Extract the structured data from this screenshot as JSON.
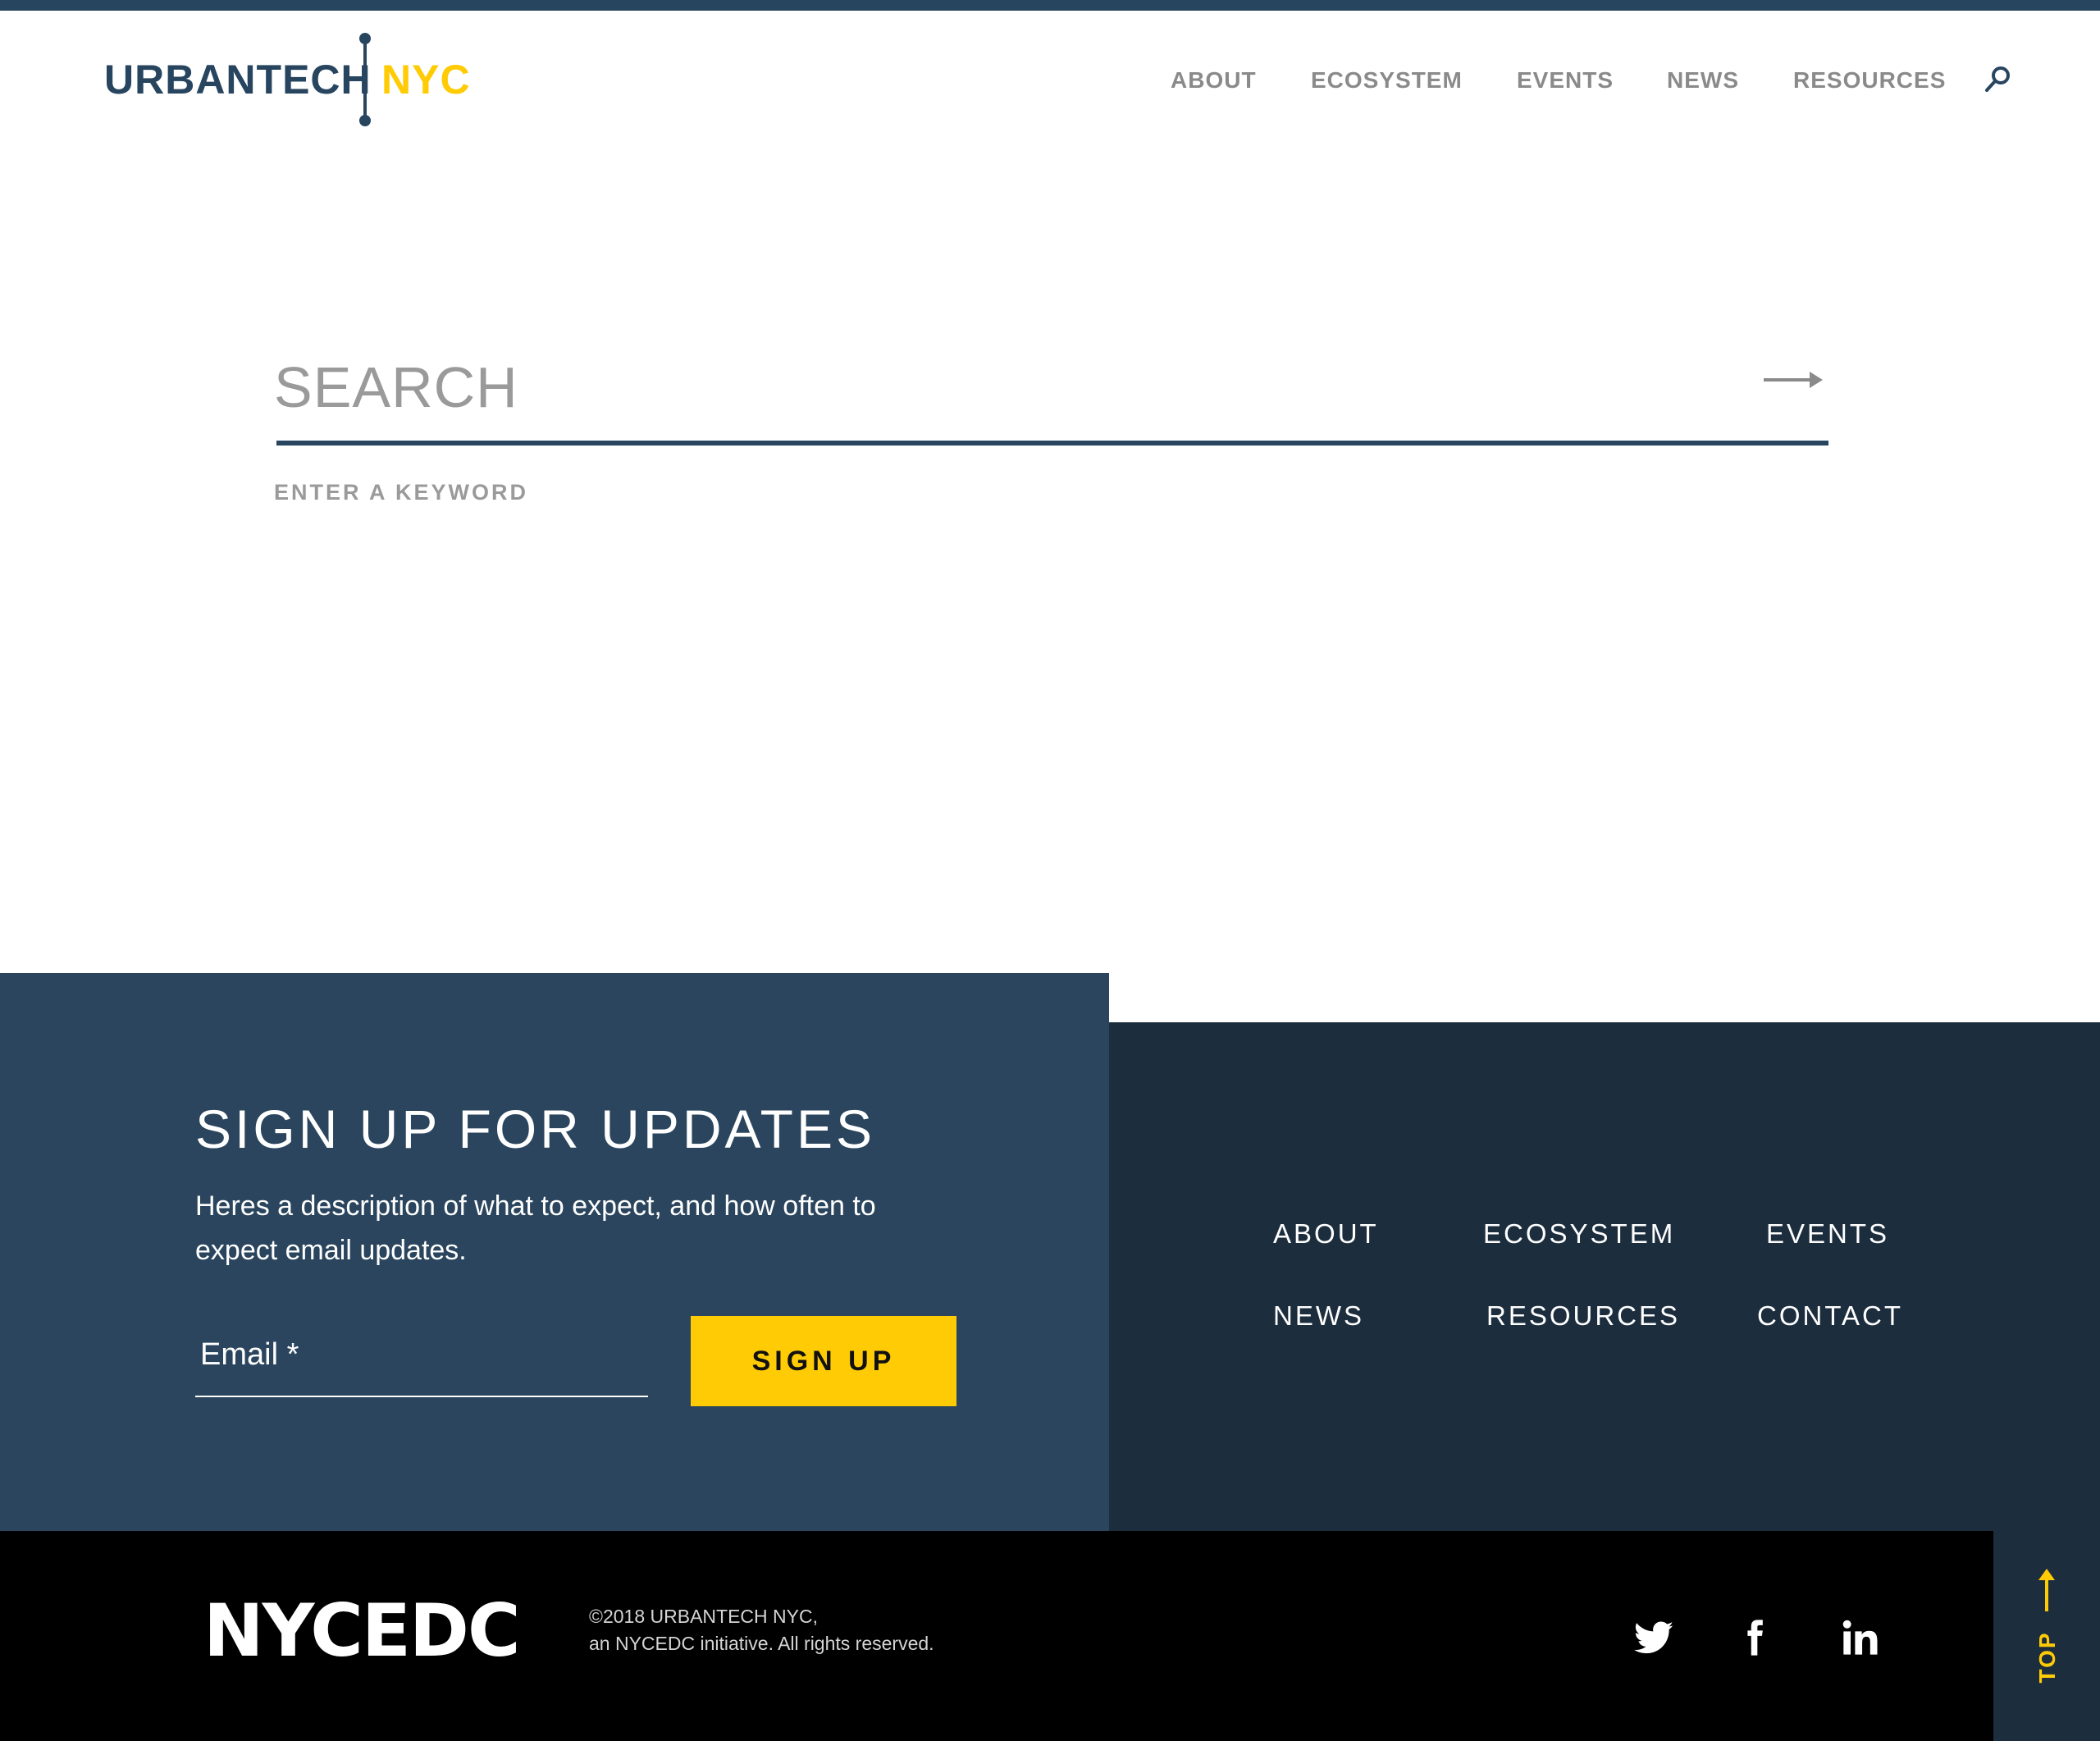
{
  "header": {
    "logo_left": "URBANTECH",
    "logo_right": "NYC",
    "nav": [
      "ABOUT",
      "ECOSYSTEM",
      "EVENTS",
      "NEWS",
      "RESOURCES"
    ],
    "search_icon": "search-icon"
  },
  "search": {
    "placeholder": "SEARCH",
    "hint": "ENTER A KEYWORD",
    "submit_icon": "arrow-right-icon"
  },
  "signup": {
    "title": "SIGN UP FOR UPDATES",
    "description": "Heres a description of what to expect, and how often to expect email updates.",
    "email_label": "Email *",
    "button": "SIGN UP"
  },
  "footer_links": [
    "ABOUT",
    "ECOSYSTEM",
    "EVENTS",
    "NEWS",
    "RESOURCES",
    "CONTACT"
  ],
  "bottom": {
    "brand": "NYCEDC",
    "copyright_line1": "©2018 URBANTECH NYC,",
    "copyright_line2": "an NYCEDC initiative. All rights reserved.",
    "social": [
      "twitter-icon",
      "facebook-icon",
      "linkedin-icon"
    ],
    "top_label": "TOP"
  },
  "colors": {
    "navy": "#284560",
    "dark_navy": "#1c2d3e",
    "accent_yellow": "#ffcb05",
    "gray_text": "#8a8a8a"
  }
}
